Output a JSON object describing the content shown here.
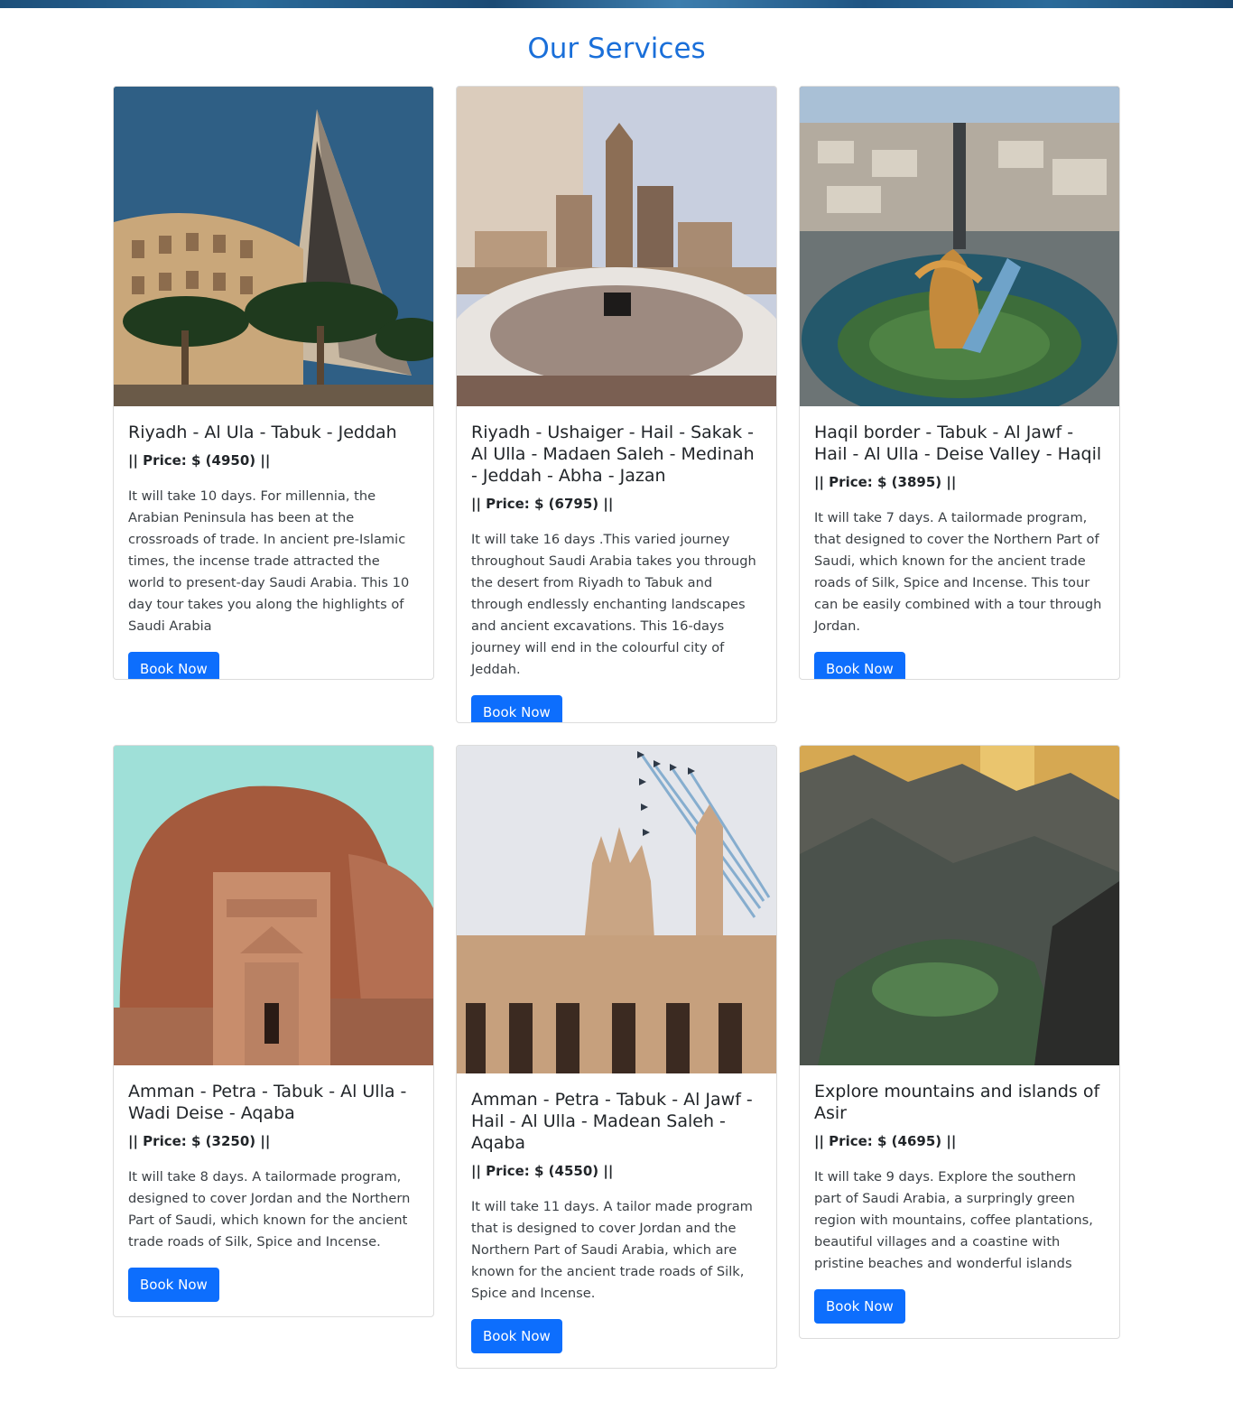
{
  "page": {
    "title": "Our Services",
    "accent_color": "#1a6fd9",
    "button_color": "#0d6efd"
  },
  "services": [
    {
      "title": "Riyadh - Al Ula - Tabuk - Jeddah",
      "price": "|| Price: $ (4950) ||",
      "description": "It will take 10 days. For millennia, the Arabian Peninsula has been at the crossroads of trade. In ancient pre-Islamic times, the incense trade attracted the world to present-day Saudi Arabia. This 10 day tour takes you along the highlights of Saudi Arabia",
      "button_label": "Book Now"
    },
    {
      "title": "Riyadh - Ushaiger - Hail - Sakak - Al Ulla - Madaen Saleh - Medinah - Jeddah - Abha - Jazan",
      "price": "|| Price: $ (6795) ||",
      "description": "It will take 16 days .This varied journey throughout Saudi Arabia takes you through the desert from Riyadh to Tabuk and through endlessly enchanting landscapes and ancient excavations. This 16-days journey will end in the colourful city of Jeddah.",
      "button_label": "Book Now"
    },
    {
      "title": "Haqil border - Tabuk - Al Jawf - Hail - Al Ulla - Deise Valley - Haqil",
      "price": "|| Price: $ (3895) ||",
      "description": "It will take 7 days. A tailormade program, that designed to cover the Northern Part of Saudi, which known for the ancient trade roads of Silk, Spice and Incense. This tour can be easily combined with a tour through Jordan.",
      "button_label": "Book Now"
    },
    {
      "title": "Amman - Petra - Tabuk - Al Ulla - Wadi Deise - Aqaba",
      "price": "|| Price: $ (3250) ||",
      "description": "It will take 8 days. A tailormade program, designed to cover Jordan and the Northern Part of Saudi, which known for the ancient trade roads of Silk, Spice and Incense.",
      "button_label": "Book Now"
    },
    {
      "title": "Amman - Petra - Tabuk - Al Jawf - Hail - Al Ulla - Madean Saleh - Aqaba",
      "price": "|| Price: $ (4550) ||",
      "description": "It will take 11 days. A tailor made program that is designed to cover Jordan and the Northern Part of Saudi Arabia, which are known for the ancient trade roads of Silk, Spice and Incense.",
      "button_label": "Book Now"
    },
    {
      "title": "Explore mountains and islands of Asir",
      "price": "|| Price: $ (4695) ||",
      "description": "It will take 9 days. Explore the southern part of Saudi Arabia, a surpringly green region with mountains, coffee plantations, beautiful villages and a coastine with pristine beaches and wonderful islands",
      "button_label": "Book Now"
    }
  ]
}
